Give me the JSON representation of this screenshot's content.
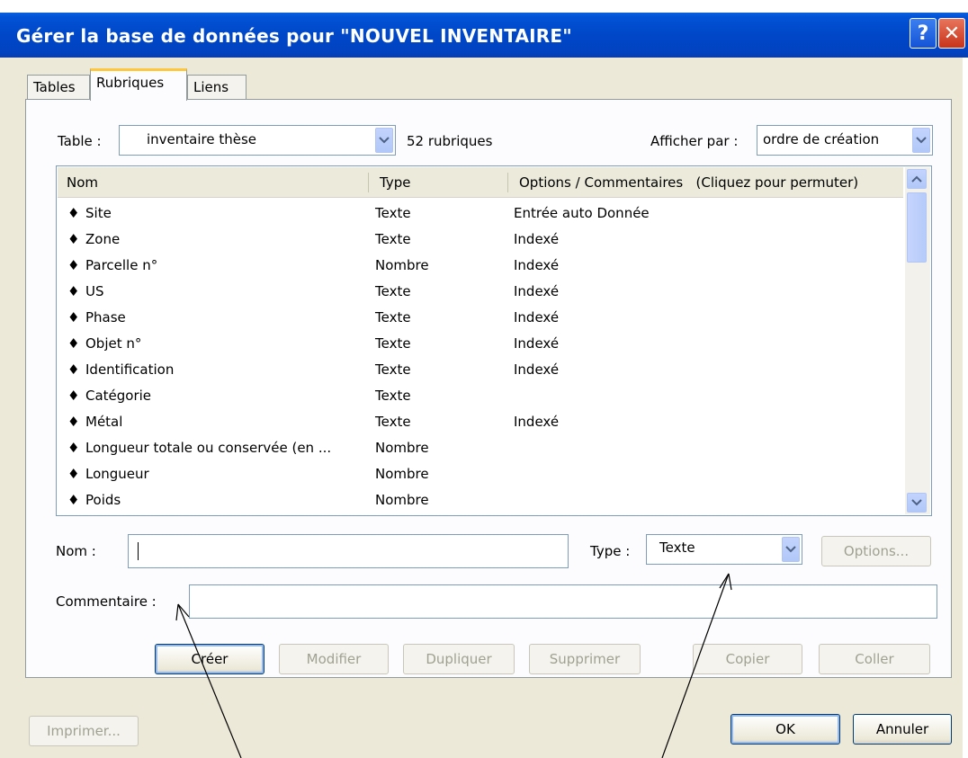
{
  "window": {
    "title": "Gérer la base de données pour \"NOUVEL INVENTAIRE\"",
    "help_glyph": "?",
    "close_glyph": "✕"
  },
  "tabs": [
    {
      "label": "Tables"
    },
    {
      "label": "Rubriques"
    },
    {
      "label": "Liens"
    }
  ],
  "table_selector": {
    "label": "Table :",
    "value": "inventaire thèse",
    "count": "52 rubriques"
  },
  "sort_selector": {
    "label": "Afficher par :",
    "value": "ordre de création"
  },
  "columns": {
    "name": "Nom",
    "type": "Type",
    "options": "Options / Commentaires   (Cliquez pour permuter)"
  },
  "rows": [
    {
      "name": "Site",
      "type": "Texte",
      "options": "Entrée auto Donnée"
    },
    {
      "name": "Zone",
      "type": "Texte",
      "options": "Indexé"
    },
    {
      "name": "Parcelle n°",
      "type": "Nombre",
      "options": "Indexé"
    },
    {
      "name": "US",
      "type": "Texte",
      "options": "Indexé"
    },
    {
      "name": "Phase",
      "type": "Texte",
      "options": "Indexé"
    },
    {
      "name": "Objet n°",
      "type": "Texte",
      "options": "Indexé"
    },
    {
      "name": "Identification",
      "type": "Texte",
      "options": "Indexé"
    },
    {
      "name": "Catégorie",
      "type": "Texte",
      "options": ""
    },
    {
      "name": "Métal",
      "type": "Texte",
      "options": "Indexé"
    },
    {
      "name": "Longueur totale ou conservée (en ...",
      "type": "Nombre",
      "options": ""
    },
    {
      "name": "Longueur",
      "type": "Nombre",
      "options": ""
    },
    {
      "name": "Poids",
      "type": "Nombre",
      "options": ""
    }
  ],
  "row_bullet": "♦",
  "form": {
    "name_label": "Nom :",
    "name_value": "",
    "type_label": "Type :",
    "type_value": "Texte",
    "options_label": "Options...",
    "comment_label": "Commentaire :",
    "comment_value": ""
  },
  "actions": {
    "create": "Créer",
    "modify": "Modifier",
    "duplicate": "Dupliquer",
    "delete": "Supprimer",
    "copy": "Copier",
    "paste": "Coller"
  },
  "footer": {
    "print": "Imprimer...",
    "ok": "OK",
    "cancel": "Annuler"
  }
}
